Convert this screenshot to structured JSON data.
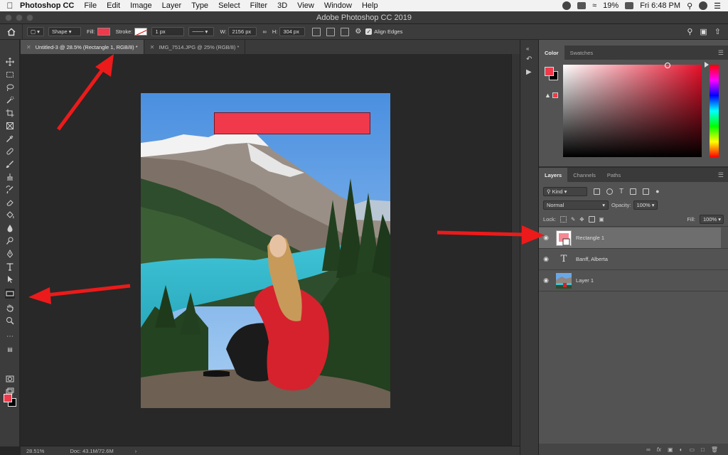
{
  "menubar": {
    "app_name": "Photoshop CC",
    "menus": [
      "File",
      "Edit",
      "Image",
      "Layer",
      "Type",
      "Select",
      "Filter",
      "3D",
      "View",
      "Window",
      "Help"
    ],
    "battery": "19%",
    "clock": "Fri 6:48 PM"
  },
  "window": {
    "title": "Adobe Photoshop CC 2019"
  },
  "options": {
    "mode": "Shape",
    "fill_label": "Fill:",
    "fill_color": "#f0394b",
    "stroke_label": "Stroke:",
    "stroke_width": "1 px",
    "w_label": "W:",
    "w_value": "2156 px",
    "h_label": "H:",
    "h_value": "304 px",
    "align_edges": "Align Edges"
  },
  "tabs": [
    {
      "label": "Untitled-3 @ 28.5% (Rectangle 1, RGB/8) *",
      "active": true
    },
    {
      "label": "IMG_7514.JPG @ 25% (RGB/8) *",
      "active": false
    }
  ],
  "status": {
    "zoom": "28.51%",
    "doc": "Doc: 43.1M/72.6M"
  },
  "color_panel": {
    "tabs": [
      "Color",
      "Swatches"
    ],
    "fg": "#f0394b",
    "bg": "#000000"
  },
  "layers_panel": {
    "tabs": [
      "Layers",
      "Channels",
      "Paths"
    ],
    "filter": "Kind",
    "blend_mode": "Normal",
    "opacity_label": "Opacity:",
    "opacity": "100%",
    "lock_label": "Lock:",
    "fill_label": "Fill:",
    "fill": "100%",
    "layers": [
      {
        "name": "Rectangle 1",
        "selected": true
      },
      {
        "name": "Banff, Alberta",
        "selected": false
      },
      {
        "name": "Layer 1",
        "selected": false
      }
    ]
  },
  "tools": [
    "move-tool",
    "marquee-tool",
    "lasso-tool",
    "quick-select-tool",
    "crop-tool",
    "frame-tool",
    "eyedropper-tool",
    "healing-tool",
    "brush-tool",
    "clone-stamp-tool",
    "history-brush-tool",
    "eraser-tool",
    "paint-bucket-tool",
    "blur-tool",
    "dodge-tool",
    "pen-tool",
    "type-tool",
    "path-select-tool",
    "rectangle-tool",
    "hand-tool",
    "zoom-tool",
    "more-tools"
  ]
}
